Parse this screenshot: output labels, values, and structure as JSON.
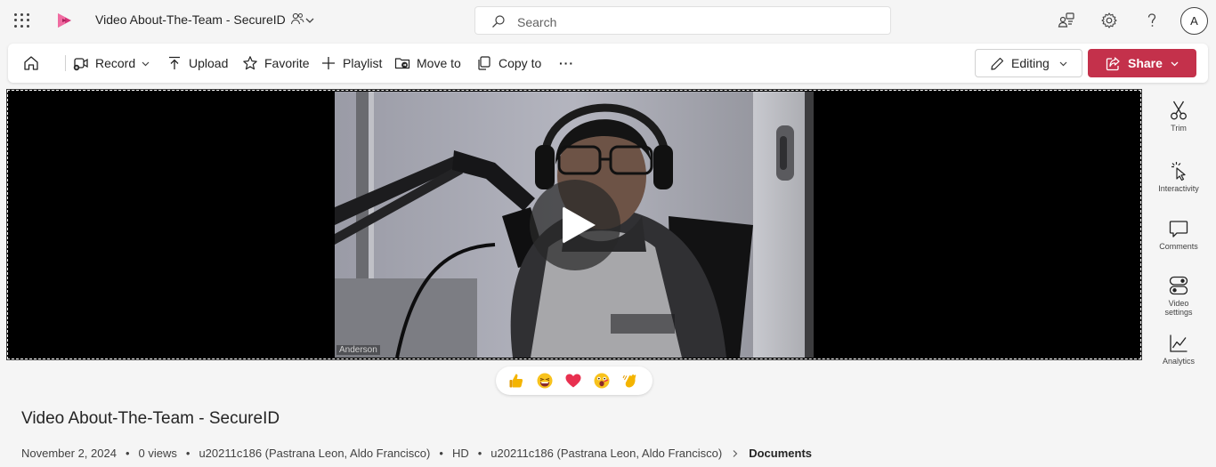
{
  "app": {
    "title": "Video About-The-Team - SecureID"
  },
  "search": {
    "placeholder": "Search"
  },
  "user": {
    "avatar_initial": "A"
  },
  "toolbar": {
    "record_label": "Record",
    "upload_label": "Upload",
    "favorite_label": "Favorite",
    "playlist_label": "Playlist",
    "move_label": "Move to",
    "copy_label": "Copy to",
    "more_label": "···",
    "editing_label": "Editing",
    "share_label": "Share"
  },
  "player": {
    "participant_name": "Anderson"
  },
  "reactions": [
    {
      "name": "like",
      "glyph": "👍"
    },
    {
      "name": "laugh",
      "glyph": "😆"
    },
    {
      "name": "heart",
      "glyph": "❤"
    },
    {
      "name": "surprised",
      "glyph": "😮"
    },
    {
      "name": "applause",
      "glyph": "👏"
    }
  ],
  "rail": {
    "trim": "Trim",
    "interactivity": "Interactivity",
    "comments": "Comments",
    "video_settings_1": "Video",
    "video_settings_2": "settings",
    "analytics": "Analytics"
  },
  "video": {
    "title": "Video About-The-Team - SecureID",
    "date": "November 2, 2024",
    "views": "0 views",
    "owner": "u20211c186 (Pastrana Leon, Aldo Francisco)",
    "quality": "HD",
    "location_owner": "u20211c186 (Pastrana Leon, Aldo Francisco)",
    "location_folder": "Documents",
    "separator": "•"
  },
  "colors": {
    "accent": "#c4314b",
    "background": "#f5f5f5",
    "logo": "#d6367a"
  }
}
